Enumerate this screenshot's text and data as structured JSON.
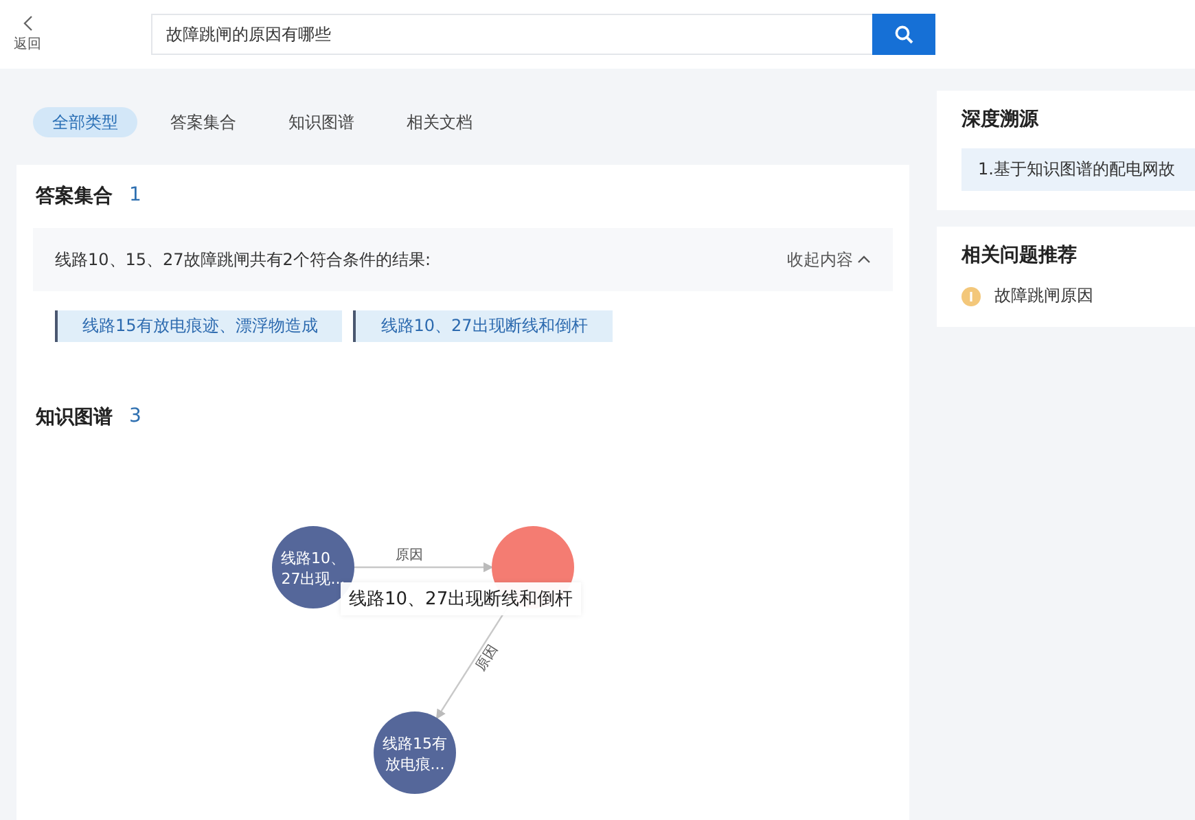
{
  "header": {
    "back_label": "返回",
    "search": {
      "value": "故障跳闸的原因有哪些"
    }
  },
  "tabs": [
    {
      "label": "全部类型",
      "selected": true
    },
    {
      "label": "答案集合",
      "selected": false
    },
    {
      "label": "知识图谱",
      "selected": false
    },
    {
      "label": "相关文档",
      "selected": false
    }
  ],
  "answers": {
    "title": "答案集合",
    "count": "1",
    "summary": "线路10、15、27故障跳闸共有2个符合条件的结果:",
    "collapse_label": "收起内容",
    "results": [
      "线路15有放电痕迹、漂浮物造成",
      "线路10、27出现断线和倒杆"
    ]
  },
  "graph": {
    "title": "知识图谱",
    "count": "3",
    "nodes": [
      {
        "label": "线路10、27出现...",
        "color": "#55679a"
      },
      {
        "color": "#f47c72"
      },
      {
        "label": "线路15有放电痕...",
        "color": "#55679a"
      }
    ],
    "edges": [
      {
        "label": "原因"
      },
      {
        "label": "原因"
      }
    ],
    "tooltip": "线路10、27出现断线和倒杆"
  },
  "trace": {
    "title": "深度溯源",
    "items": [
      "1.基于知识图谱的配电网故"
    ]
  },
  "related": {
    "title": "相关问题推荐",
    "items": [
      {
        "label": "故障跳闸原因"
      }
    ]
  }
}
